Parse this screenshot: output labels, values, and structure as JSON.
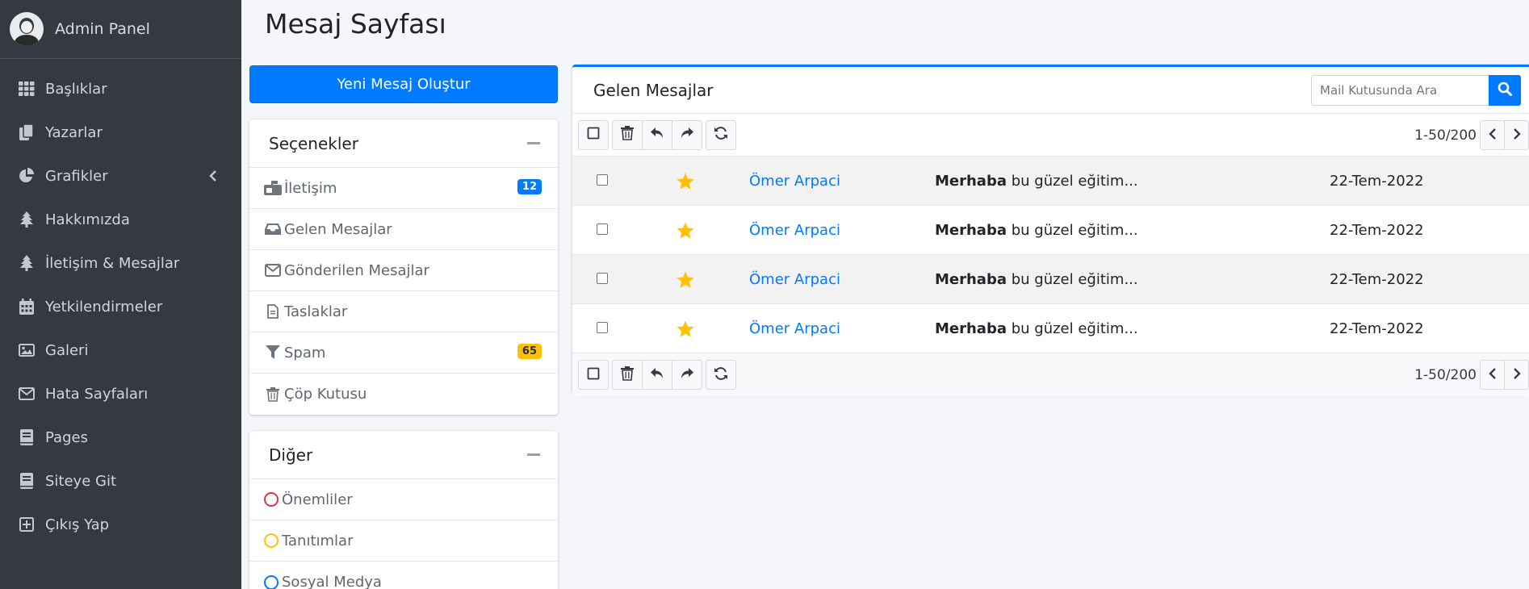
{
  "sidebar": {
    "brand": "Admin Panel",
    "items": [
      {
        "label": "Başlıklar",
        "icon": "grid-icon"
      },
      {
        "label": "Yazarlar",
        "icon": "copy-icon"
      },
      {
        "label": "Grafikler",
        "icon": "pie-chart-icon"
      },
      {
        "label": "Hakkımızda",
        "icon": "tree-icon"
      },
      {
        "label": "İletişim & Mesajlar",
        "icon": "tree-icon"
      },
      {
        "label": "Yetkilendirmeler",
        "icon": "calendar-icon"
      },
      {
        "label": "Galeri",
        "icon": "image-icon"
      },
      {
        "label": "Hata Sayfaları",
        "icon": "envelope-icon"
      },
      {
        "label": "Pages",
        "icon": "book-icon"
      },
      {
        "label": "Siteye Git",
        "icon": "book-icon"
      },
      {
        "label": "Çıkış Yap",
        "icon": "plus-square-icon"
      }
    ]
  },
  "page": {
    "title": "Mesaj Sayfası"
  },
  "compose": {
    "label": "Yeni Mesaj Oluştur"
  },
  "options": {
    "title": "Seçenekler",
    "items": [
      {
        "label": "İletişim",
        "icon": "mailbox-icon",
        "badge": "12"
      },
      {
        "label": "Gelen Mesajlar",
        "icon": "inbox-icon",
        "badge": ""
      },
      {
        "label": "Gönderilen Mesajlar",
        "icon": "envelope-icon",
        "badge": ""
      },
      {
        "label": "Taslaklar",
        "icon": "file-icon",
        "badge": ""
      },
      {
        "label": "Spam",
        "icon": "filter-icon",
        "badge": "65"
      },
      {
        "label": "Çöp Kutusu",
        "icon": "trash-icon",
        "badge": ""
      }
    ]
  },
  "other": {
    "title": "Diğer",
    "items": [
      {
        "label": "Önemliler",
        "color": "#dc3545"
      },
      {
        "label": "Tanıtımlar",
        "color": "#ffc107"
      },
      {
        "label": "Sosyal Medya",
        "color": "#007bff"
      }
    ]
  },
  "mailbox": {
    "title": "Gelen Mesajlar",
    "search_placeholder": "Mail Kutusunda Ara",
    "pager_text": "1-50/200",
    "messages": [
      {
        "sender": "Ömer Arpaci",
        "subject_bold": "Merhaba",
        "subject_rest": " bu güzel eğitim...",
        "date": "22-Tem-2022"
      },
      {
        "sender": "Ömer Arpaci",
        "subject_bold": "Merhaba",
        "subject_rest": " bu güzel eğitim...",
        "date": "22-Tem-2022"
      },
      {
        "sender": "Ömer Arpaci",
        "subject_bold": "Merhaba",
        "subject_rest": " bu güzel eğitim...",
        "date": "22-Tem-2022"
      },
      {
        "sender": "Ömer Arpaci",
        "subject_bold": "Merhaba",
        "subject_rest": " bu güzel eğitim...",
        "date": "22-Tem-2022"
      }
    ]
  },
  "colors": {
    "accent": "#007bff",
    "sidebar_bg": "#343a40",
    "star": "#ffc107"
  }
}
